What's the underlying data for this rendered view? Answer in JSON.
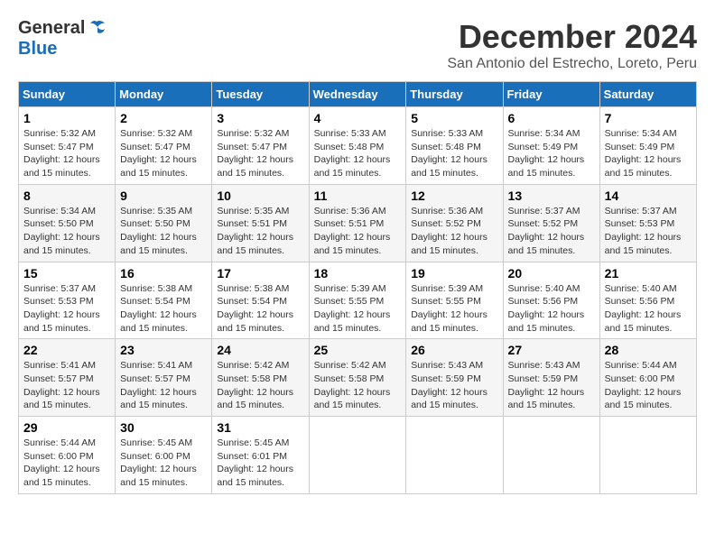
{
  "logo": {
    "general": "General",
    "blue": "Blue"
  },
  "title": "December 2024",
  "location": "San Antonio del Estrecho, Loreto, Peru",
  "headers": [
    "Sunday",
    "Monday",
    "Tuesday",
    "Wednesday",
    "Thursday",
    "Friday",
    "Saturday"
  ],
  "weeks": [
    [
      {
        "day": "1",
        "sunrise": "5:32 AM",
        "sunset": "5:47 PM",
        "daylight": "12 hours and 15 minutes."
      },
      {
        "day": "2",
        "sunrise": "5:32 AM",
        "sunset": "5:47 PM",
        "daylight": "12 hours and 15 minutes."
      },
      {
        "day": "3",
        "sunrise": "5:32 AM",
        "sunset": "5:47 PM",
        "daylight": "12 hours and 15 minutes."
      },
      {
        "day": "4",
        "sunrise": "5:33 AM",
        "sunset": "5:48 PM",
        "daylight": "12 hours and 15 minutes."
      },
      {
        "day": "5",
        "sunrise": "5:33 AM",
        "sunset": "5:48 PM",
        "daylight": "12 hours and 15 minutes."
      },
      {
        "day": "6",
        "sunrise": "5:34 AM",
        "sunset": "5:49 PM",
        "daylight": "12 hours and 15 minutes."
      },
      {
        "day": "7",
        "sunrise": "5:34 AM",
        "sunset": "5:49 PM",
        "daylight": "12 hours and 15 minutes."
      }
    ],
    [
      {
        "day": "8",
        "sunrise": "5:34 AM",
        "sunset": "5:50 PM",
        "daylight": "12 hours and 15 minutes."
      },
      {
        "day": "9",
        "sunrise": "5:35 AM",
        "sunset": "5:50 PM",
        "daylight": "12 hours and 15 minutes."
      },
      {
        "day": "10",
        "sunrise": "5:35 AM",
        "sunset": "5:51 PM",
        "daylight": "12 hours and 15 minutes."
      },
      {
        "day": "11",
        "sunrise": "5:36 AM",
        "sunset": "5:51 PM",
        "daylight": "12 hours and 15 minutes."
      },
      {
        "day": "12",
        "sunrise": "5:36 AM",
        "sunset": "5:52 PM",
        "daylight": "12 hours and 15 minutes."
      },
      {
        "day": "13",
        "sunrise": "5:37 AM",
        "sunset": "5:52 PM",
        "daylight": "12 hours and 15 minutes."
      },
      {
        "day": "14",
        "sunrise": "5:37 AM",
        "sunset": "5:53 PM",
        "daylight": "12 hours and 15 minutes."
      }
    ],
    [
      {
        "day": "15",
        "sunrise": "5:37 AM",
        "sunset": "5:53 PM",
        "daylight": "12 hours and 15 minutes."
      },
      {
        "day": "16",
        "sunrise": "5:38 AM",
        "sunset": "5:54 PM",
        "daylight": "12 hours and 15 minutes."
      },
      {
        "day": "17",
        "sunrise": "5:38 AM",
        "sunset": "5:54 PM",
        "daylight": "12 hours and 15 minutes."
      },
      {
        "day": "18",
        "sunrise": "5:39 AM",
        "sunset": "5:55 PM",
        "daylight": "12 hours and 15 minutes."
      },
      {
        "day": "19",
        "sunrise": "5:39 AM",
        "sunset": "5:55 PM",
        "daylight": "12 hours and 15 minutes."
      },
      {
        "day": "20",
        "sunrise": "5:40 AM",
        "sunset": "5:56 PM",
        "daylight": "12 hours and 15 minutes."
      },
      {
        "day": "21",
        "sunrise": "5:40 AM",
        "sunset": "5:56 PM",
        "daylight": "12 hours and 15 minutes."
      }
    ],
    [
      {
        "day": "22",
        "sunrise": "5:41 AM",
        "sunset": "5:57 PM",
        "daylight": "12 hours and 15 minutes."
      },
      {
        "day": "23",
        "sunrise": "5:41 AM",
        "sunset": "5:57 PM",
        "daylight": "12 hours and 15 minutes."
      },
      {
        "day": "24",
        "sunrise": "5:42 AM",
        "sunset": "5:58 PM",
        "daylight": "12 hours and 15 minutes."
      },
      {
        "day": "25",
        "sunrise": "5:42 AM",
        "sunset": "5:58 PM",
        "daylight": "12 hours and 15 minutes."
      },
      {
        "day": "26",
        "sunrise": "5:43 AM",
        "sunset": "5:59 PM",
        "daylight": "12 hours and 15 minutes."
      },
      {
        "day": "27",
        "sunrise": "5:43 AM",
        "sunset": "5:59 PM",
        "daylight": "12 hours and 15 minutes."
      },
      {
        "day": "28",
        "sunrise": "5:44 AM",
        "sunset": "6:00 PM",
        "daylight": "12 hours and 15 minutes."
      }
    ],
    [
      {
        "day": "29",
        "sunrise": "5:44 AM",
        "sunset": "6:00 PM",
        "daylight": "12 hours and 15 minutes."
      },
      {
        "day": "30",
        "sunrise": "5:45 AM",
        "sunset": "6:00 PM",
        "daylight": "12 hours and 15 minutes."
      },
      {
        "day": "31",
        "sunrise": "5:45 AM",
        "sunset": "6:01 PM",
        "daylight": "12 hours and 15 minutes."
      },
      null,
      null,
      null,
      null
    ]
  ]
}
